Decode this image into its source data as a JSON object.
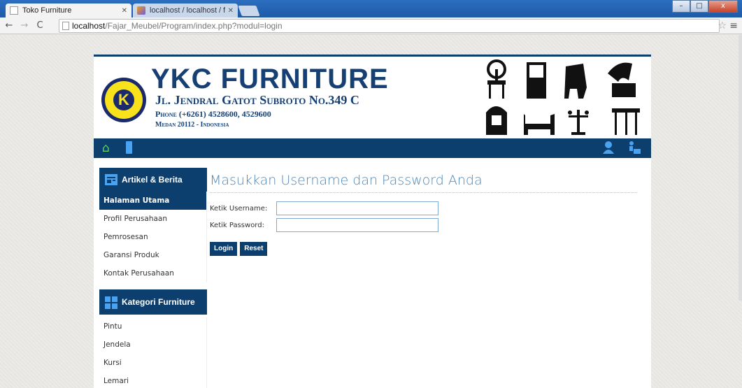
{
  "browser": {
    "tabs": [
      {
        "title": "Toko Furniture",
        "active": true
      },
      {
        "title": "localhost / localhost / faz",
        "active": false
      }
    ],
    "url_host": "localhost",
    "url_path": "/Fajar_Meubel/Program/index.php?modul=login",
    "window_controls": {
      "minimize": "–",
      "maximize": "□",
      "close": "x"
    }
  },
  "header": {
    "brand": "YKC FURNITURE",
    "address": "Jl. Jendral Gatot Subroto No.349 C",
    "phone": "Phone (+6261) 4528600, 4529600",
    "city": "Medan 20112 - Indonesia",
    "logo_letter": "K"
  },
  "navbar": {
    "left_icons": [
      "home-icon",
      "mobile-icon"
    ],
    "right_icons": [
      "user-icon",
      "customer-icon"
    ]
  },
  "sidebar": {
    "section1": {
      "title": "Artikel & Berita",
      "items": [
        "Halaman Utama",
        "Profil Perusahaan",
        "Pemrosesan",
        "Garansi Produk",
        "Kontak Perusahaan"
      ],
      "active_index": 0
    },
    "section2": {
      "title": "Kategori Furniture",
      "items": [
        "Pintu",
        "Jendela",
        "Kursi",
        "Lemari"
      ]
    }
  },
  "login": {
    "title": "Masukkan Username dan Password Anda",
    "username_label": "Ketik Username:",
    "password_label": "Ketik Password:",
    "username_value": "",
    "password_value": "",
    "login_button": "Login",
    "reset_button": "Reset"
  },
  "colors": {
    "navy": "#0d3f6e",
    "brand_text": "#163f74",
    "title_blue": "#4a86b8",
    "logo_yellow": "#f7e21b"
  }
}
